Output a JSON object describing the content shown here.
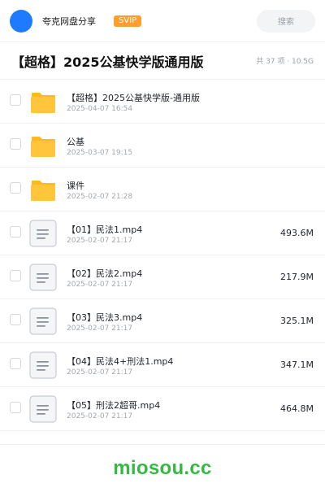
{
  "header": {
    "user_name": "夸克网盘分享",
    "badge": "SVIP",
    "search_placeholder": "搜索"
  },
  "title_bar": {
    "title": "【超格】2025公基快学版通用版",
    "meta": "共 37 项 · 10.5G"
  },
  "files": [
    {
      "type": "folder",
      "icon": "folder-icon",
      "name": "【超格】2025公基快学版-通用版",
      "date": "2025-04-07 16:54",
      "size": ""
    },
    {
      "type": "folder",
      "icon": "folder-icon",
      "name": "公基",
      "date": "2025-03-07 19:15",
      "size": ""
    },
    {
      "type": "folder",
      "icon": "folder-icon",
      "name": "课件",
      "date": "2025-02-07 21:28",
      "size": ""
    },
    {
      "type": "file",
      "icon": "document-icon",
      "name": "【01】民法1.mp4",
      "date": "2025-02-07 21:17",
      "size": "493.6M"
    },
    {
      "type": "file",
      "icon": "document-icon",
      "name": "【02】民法2.mp4",
      "date": "2025-02-07 21:17",
      "size": "217.9M"
    },
    {
      "type": "file",
      "icon": "document-icon",
      "name": "【03】民法3.mp4",
      "date": "2025-02-07 21:17",
      "size": "325.1M"
    },
    {
      "type": "file",
      "icon": "document-icon",
      "name": "【04】民法4+刑法1.mp4",
      "date": "2025-02-07 21:17",
      "size": "347.1M"
    },
    {
      "type": "file",
      "icon": "document-icon",
      "name": "【05】刑法2超哥.mp4",
      "date": "2025-02-07 21:17",
      "size": "464.8M"
    }
  ],
  "footer": {
    "watermark": "miosou.cc"
  },
  "colors": {
    "avatar": "#1e7bff",
    "badge": "#ff9e2c",
    "folder": "#ffc53d",
    "watermark": "#35b844"
  }
}
